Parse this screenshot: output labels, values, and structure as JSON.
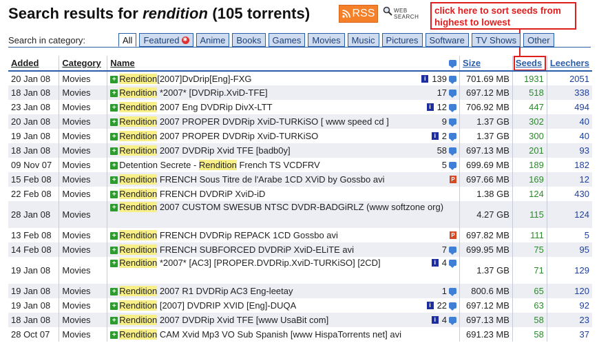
{
  "header": {
    "title_prefix": "Search results for ",
    "title_query": "rendition",
    "title_suffix": " (105 torrents)",
    "rss_label": "RSS",
    "web_search_line1": "WEB",
    "web_search_line2": "SEARCH"
  },
  "annotation": {
    "text": "click here to sort seeds from highest to lowest",
    "color": "#e21d1d"
  },
  "categories": {
    "label": "Search in category:",
    "tabs": [
      "All",
      "Featured",
      "Anime",
      "Books",
      "Games",
      "Movies",
      "Music",
      "Pictures",
      "Software",
      "TV Shows",
      "Other"
    ],
    "active": "All"
  },
  "table": {
    "columns": {
      "added": "Added",
      "category": "Category",
      "name": "Name",
      "size": "Size",
      "seeds": "Seeds",
      "leechers": "Leechers"
    },
    "rows": [
      {
        "added": "20 Jan 08",
        "category": "Movies",
        "pre": "",
        "hl": "Rendition",
        "post": "[2007]DvDrip[Eng]-FXG",
        "info": true,
        "p": false,
        "comments": "139",
        "size": "701.69 MB",
        "seeds": "1931",
        "leechers": "2051"
      },
      {
        "added": "18 Jan 08",
        "category": "Movies",
        "pre": "",
        "hl": "Rendition",
        "post": " *2007* [DVDRip.XviD-TFE]",
        "info": false,
        "p": false,
        "comments": "17",
        "size": "697.12 MB",
        "seeds": "518",
        "leechers": "338"
      },
      {
        "added": "23 Jan 08",
        "category": "Movies",
        "pre": "",
        "hl": "Rendition",
        "post": " 2007 Eng DVDRip DivX-LTT",
        "info": true,
        "p": false,
        "comments": "12",
        "size": "706.92 MB",
        "seeds": "447",
        "leechers": "494"
      },
      {
        "added": "20 Jan 08",
        "category": "Movies",
        "pre": "",
        "hl": "Rendition",
        "post": " 2007 PROPER DVDRip XviD-TURKiSO [ www speed cd ]",
        "info": false,
        "p": false,
        "comments": "9",
        "size": "1.37 GB",
        "seeds": "302",
        "leechers": "40"
      },
      {
        "added": "19 Jan 08",
        "category": "Movies",
        "pre": "",
        "hl": "Rendition",
        "post": " 2007 PROPER DVDRip XviD-TURKiSO",
        "info": true,
        "p": false,
        "comments": "2",
        "size": "1.37 GB",
        "seeds": "300",
        "leechers": "40"
      },
      {
        "added": "18 Jan 08",
        "category": "Movies",
        "pre": "",
        "hl": "Rendition",
        "post": " 2007 DVDRip Xvid TFE [badb0y]",
        "info": false,
        "p": false,
        "comments": "58",
        "size": "697.13 MB",
        "seeds": "201",
        "leechers": "93"
      },
      {
        "added": "09 Nov 07",
        "category": "Movies",
        "pre": "Detention Secrete - ",
        "hl": "Rendition",
        "post": " French TS VCDFRV",
        "info": false,
        "p": false,
        "comments": "5",
        "size": "699.69 MB",
        "seeds": "189",
        "leechers": "182"
      },
      {
        "added": "15 Feb 08",
        "category": "Movies",
        "pre": "",
        "hl": "Rendition",
        "post": " FRENCH Sous Titre de l'Arabe 1CD XViD by Gossbo avi",
        "info": false,
        "p": true,
        "comments": "",
        "size": "697.66 MB",
        "seeds": "169",
        "leechers": "12"
      },
      {
        "added": "22 Feb 08",
        "category": "Movies",
        "pre": "",
        "hl": "Rendition",
        "post": " FRENCH DVDRiP XviD-iD",
        "info": false,
        "p": false,
        "comments": "",
        "size": "1.38 GB",
        "seeds": "124",
        "leechers": "430"
      },
      {
        "added": "28 Jan 08",
        "category": "Movies",
        "pre": "",
        "hl": "Rendition",
        "post": " 2007 CUSTOM SWESUB NTSC DVDR-BADGiRLZ (www softzone org)",
        "info": false,
        "p": false,
        "comments": "",
        "size": "4.27 GB",
        "seeds": "115",
        "leechers": "124",
        "tall": true
      },
      {
        "added": "13 Feb 08",
        "category": "Movies",
        "pre": "",
        "hl": "Rendition",
        "post": " FRENCH DVDRip REPACK 1CD Gossbo avi",
        "info": false,
        "p": true,
        "comments": "",
        "size": "697.82 MB",
        "seeds": "111",
        "leechers": "5"
      },
      {
        "added": "14 Feb 08",
        "category": "Movies",
        "pre": "",
        "hl": "Rendition",
        "post": " FRENCH SUBFORCED DVDRiP XviD-ELiTE avi",
        "info": false,
        "p": false,
        "comments": "7",
        "size": "699.95 MB",
        "seeds": "75",
        "leechers": "95"
      },
      {
        "added": "19 Jan 08",
        "category": "Movies",
        "pre": "",
        "hl": "Rendition",
        "post": " *2007* [AC3] [PROPER.DVDRip.XviD-TURKiSO] [2CD]",
        "info": true,
        "p": false,
        "comments": "4",
        "size": "1.37 GB",
        "seeds": "71",
        "leechers": "129",
        "tall": true
      },
      {
        "added": "19 Jan 08",
        "category": "Movies",
        "pre": "",
        "hl": "Rendition",
        "post": " 2007 R1 DVDRip AC3 Eng-leetay",
        "info": false,
        "p": false,
        "comments": "1",
        "size": "800.6 MB",
        "seeds": "65",
        "leechers": "120"
      },
      {
        "added": "19 Jan 08",
        "category": "Movies",
        "pre": "",
        "hl": "Rendition",
        "post": " [2007] DVDRIP XVID [Eng]-DUQA",
        "info": true,
        "p": false,
        "comments": "22",
        "size": "697.12 MB",
        "seeds": "63",
        "leechers": "92"
      },
      {
        "added": "18 Jan 08",
        "category": "Movies",
        "pre": "",
        "hl": "Rendition",
        "post": " 2007 DVDRip Xvid TFE [www UsaBit com]",
        "info": true,
        "p": false,
        "comments": "4",
        "size": "697.13 MB",
        "seeds": "58",
        "leechers": "23"
      },
      {
        "added": "28 Oct 07",
        "category": "Movies",
        "pre": "",
        "hl": "Rendition",
        "post": " CAM Xvid Mp3 VO Sub Spanish [www HispaTorrents net] avi",
        "info": false,
        "p": false,
        "comments": "",
        "size": "691.23 MB",
        "seeds": "58",
        "leechers": "37"
      }
    ]
  },
  "colors": {
    "accent": "#2b5ea8",
    "seeds": "#2a8a2a",
    "leechers": "#1d3f9e",
    "highlight": "#f8ef86",
    "rss": "#f4812a"
  },
  "icons": {
    "rss": "rss-icon",
    "web_search": "magnifier-icon",
    "download": "plus-download-icon",
    "info": "info-icon",
    "comment": "comment-bubble-icon",
    "p": "p-badge-icon"
  }
}
